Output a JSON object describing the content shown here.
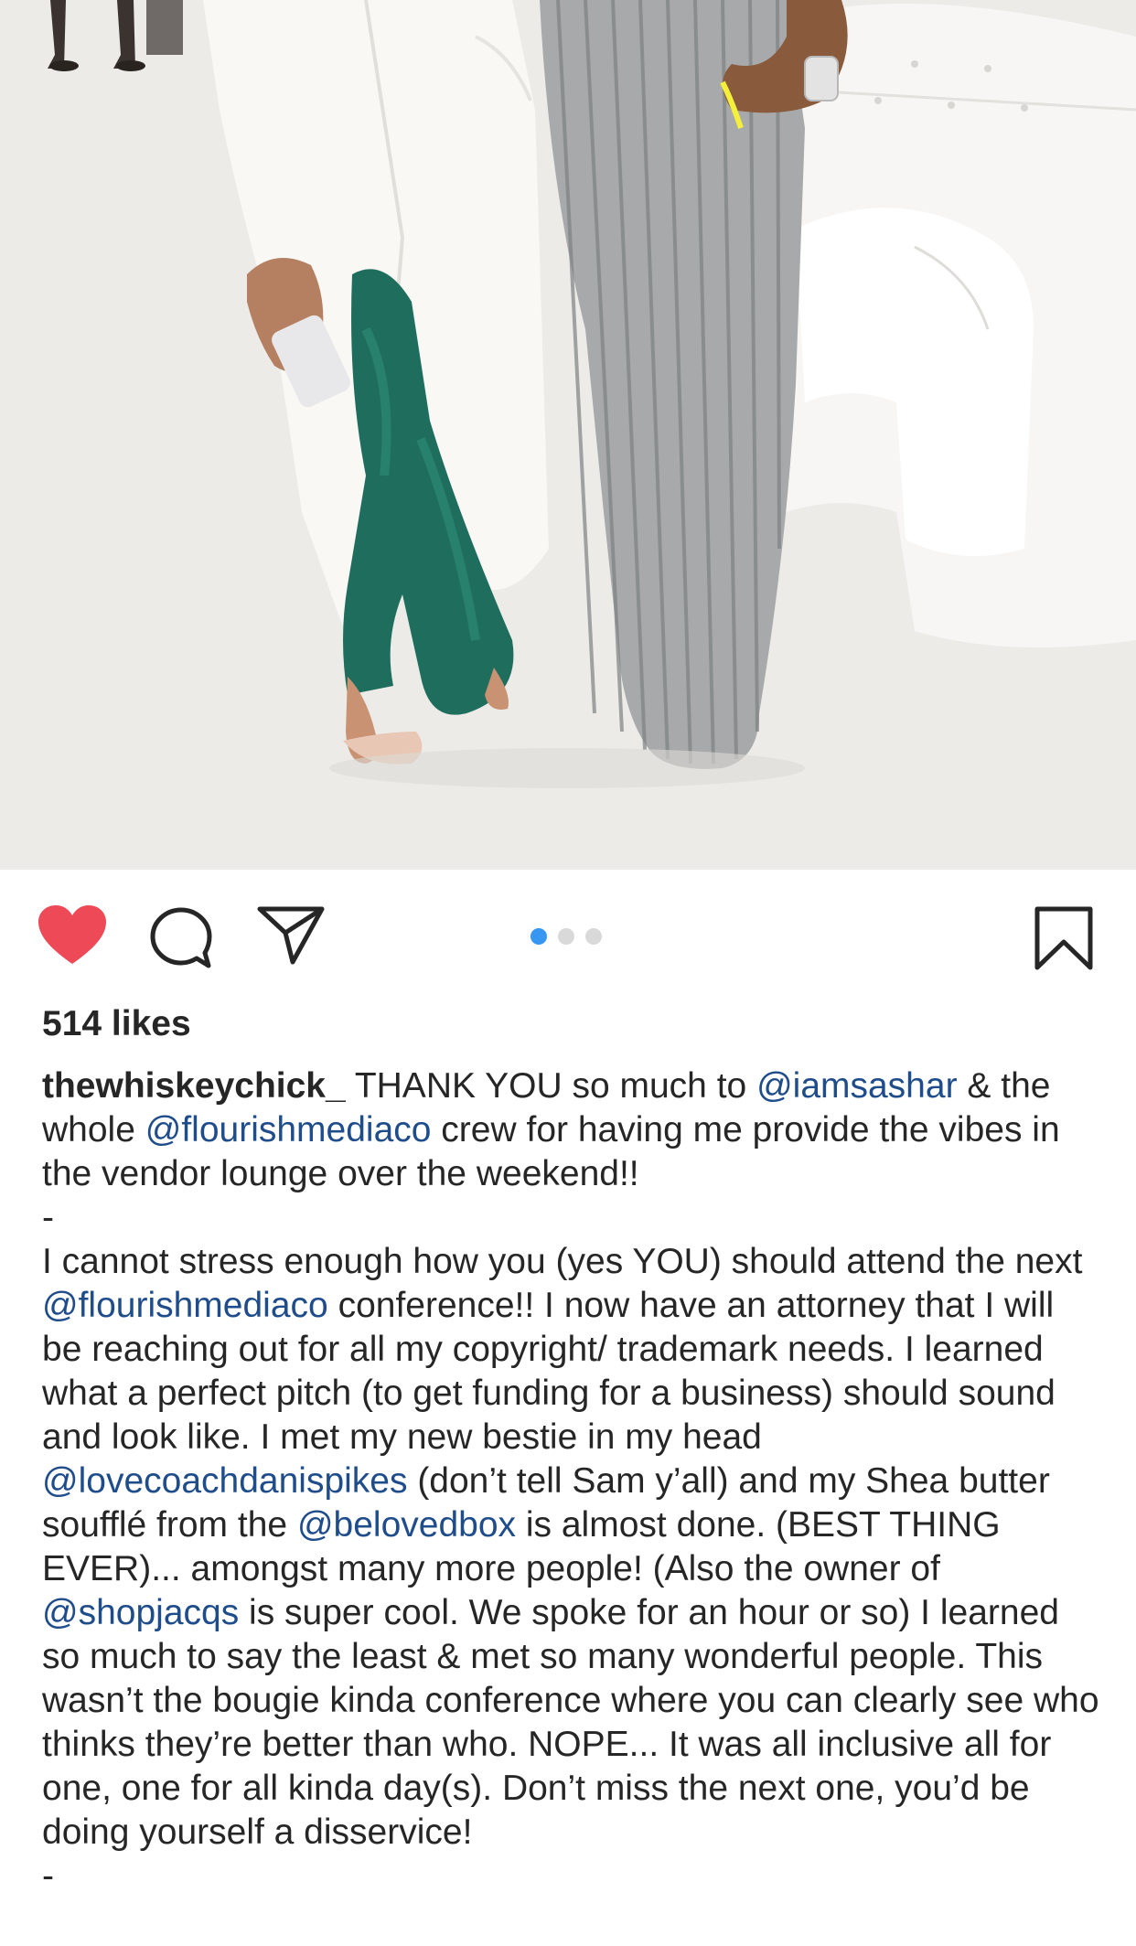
{
  "post": {
    "photo_alt": "",
    "carousel": {
      "count": 3,
      "active_index": 0
    },
    "likes_text": "514 likes",
    "liked": true,
    "username": "thewhiskeychick_"
  },
  "colors": {
    "heart": "#ed4956",
    "mention": "#1f4d8c",
    "dot_active": "#3897f0",
    "dot_inactive": "#d9d9d9",
    "text": "#262626"
  },
  "icons": {
    "like": "heart-icon",
    "comment": "comment-icon",
    "share": "share-icon",
    "save": "bookmark-icon"
  },
  "caption": {
    "p1": [
      {
        "t": "THANK YOU so much to ",
        "m": false
      },
      {
        "t": "@iamsashar",
        "m": true
      },
      {
        "t": " & the whole ",
        "m": false
      },
      {
        "t": "@flourishmediaco",
        "m": true
      },
      {
        "t": " crew for having me provide the vibes in the vendor lounge over the weekend!!",
        "m": false
      }
    ],
    "separator1": "-",
    "p2": [
      {
        "t": "I cannot stress enough how you (yes YOU) should attend the next ",
        "m": false
      },
      {
        "t": "@flourishmediaco",
        "m": true
      },
      {
        "t": " conference!! I now have an attorney that I will be reaching out for all my copyright/ trademark needs. I learned what a perfect pitch (to get funding for a business) should sound and look like. I met my new bestie in my head ",
        "m": false
      },
      {
        "t": "@lovecoachdanispikes",
        "m": true
      },
      {
        "t": " (don’t tell Sam y’all) and my Shea butter soufflé from the ",
        "m": false
      },
      {
        "t": "@belovedbox",
        "m": true
      },
      {
        "t": " is almost done. (BEST THING EVER)... amongst many more people! (Also the owner of ",
        "m": false
      },
      {
        "t": "@shopjacqs",
        "m": true
      },
      {
        "t": " is super cool. We spoke for an hour or so) I learned so much to say the least & met so many wonderful people. This wasn’t the bougie kinda conference where you can clearly see who thinks they’re better than who. NOPE... It was all inclusive all for one, one for all kinda day(s). Don’t miss the next one, you’d be doing yourself a disservice!",
        "m": false
      }
    ],
    "separator2": "-"
  }
}
